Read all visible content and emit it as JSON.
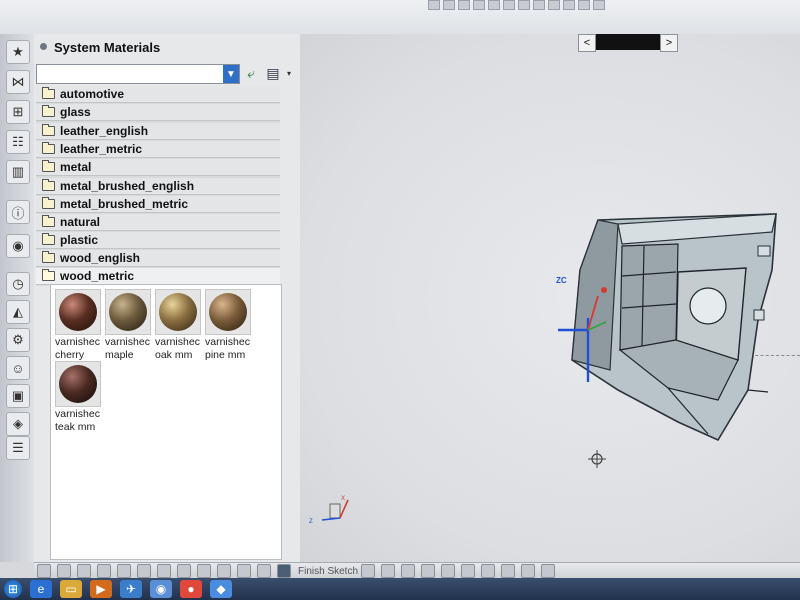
{
  "panel": {
    "title": "System Materials",
    "folders": [
      "automotive",
      "glass",
      "leather_english",
      "leather_metric",
      "metal",
      "metal_brushed_english",
      "metal_brushed_metric",
      "natural",
      "plastic",
      "wood_english",
      "wood_metric"
    ],
    "expanded_folder": "wood_metric",
    "materials": [
      {
        "line1": "varnishec",
        "line2": "cherry",
        "color": "#5a2e22"
      },
      {
        "line1": "varnishec",
        "line2": "maple",
        "color": "#6b5a3c"
      },
      {
        "line1": "varnishec",
        "line2": "oak mm",
        "color": "#8a6e40"
      },
      {
        "line1": "varnishec",
        "line2": "pine mm",
        "color": "#7a5c3a"
      },
      {
        "line1": "varnishec",
        "line2": "teak mm",
        "color": "#4a2a22"
      }
    ]
  },
  "graphics": {
    "axis_label_zc": "ZC",
    "triad_labels": {
      "x": "X",
      "z": "Z"
    }
  },
  "bottom_toolbar": {
    "finish_sketch": "Finish Sketch"
  },
  "icons": {
    "combo_dropdown": "chevron-down-icon",
    "refresh": "refresh-icon",
    "nav_prev": "chevron-left-icon",
    "nav_next": "chevron-right-icon"
  },
  "colors": {
    "accent_blue": "#2f6fc6",
    "model_fill": "#b8c4c8"
  }
}
